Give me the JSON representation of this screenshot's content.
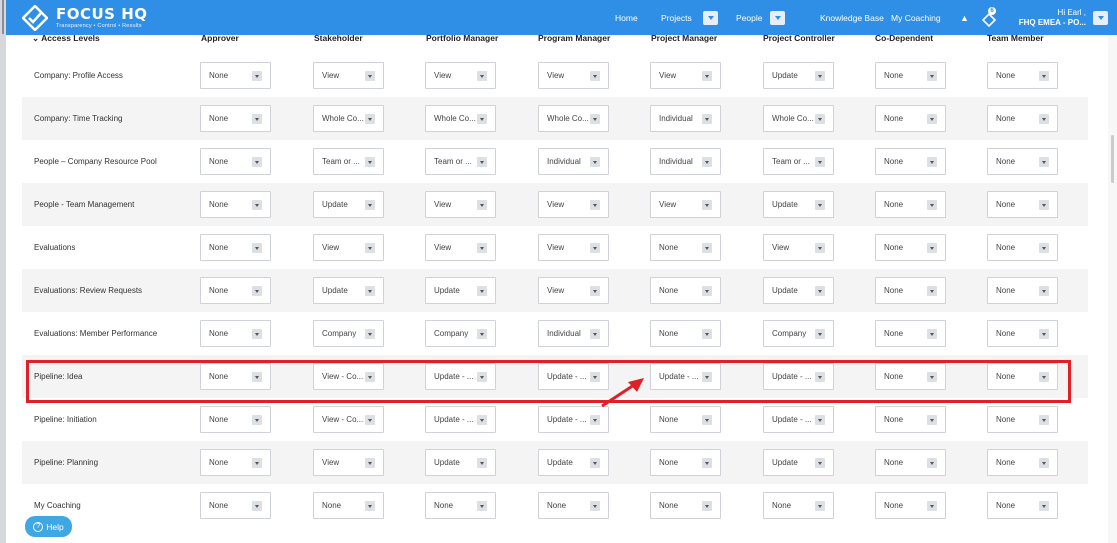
{
  "app": {
    "name": "FOCUS HQ",
    "tagline": "Transparency • Control • Results"
  },
  "nav": {
    "home": "Home",
    "projects": "Projects",
    "people": "People",
    "knowledge_base": "Knowledge Base",
    "my_coaching": "My Coaching",
    "notification_count": "6",
    "greeting": "Hi Earl ,",
    "org": "FHQ EMEA - PO..."
  },
  "table": {
    "first_header": "Access Levels",
    "columns": [
      "Approver",
      "Stakeholder",
      "Portfolio Manager",
      "Program Manager",
      "Project Manager",
      "Project Controller",
      "Co-Dependent",
      "Team Member"
    ],
    "rows": [
      {
        "label": "Company: Profile Access",
        "values": [
          "None",
          "View",
          "View",
          "View",
          "View",
          "Update",
          "None",
          "None"
        ]
      },
      {
        "label": "Company: Time Tracking",
        "values": [
          "None",
          "Whole Co...",
          "Whole Co...",
          "Whole Co...",
          "Individual",
          "Whole Co...",
          "None",
          "None"
        ]
      },
      {
        "label": "People – Company Resource Pool",
        "values": [
          "None",
          "Team or ...",
          "Team or ...",
          "Individual",
          "Individual",
          "Team or ...",
          "None",
          "None"
        ]
      },
      {
        "label": "People - Team Management",
        "values": [
          "None",
          "Update",
          "View",
          "View",
          "View",
          "Update",
          "None",
          "None"
        ]
      },
      {
        "label": "Evaluations",
        "values": [
          "None",
          "View",
          "View",
          "View",
          "None",
          "View",
          "None",
          "None"
        ]
      },
      {
        "label": "Evaluations: Review Requests",
        "values": [
          "None",
          "Update",
          "Update",
          "View",
          "None",
          "Update",
          "None",
          "None"
        ]
      },
      {
        "label": "Evaluations: Member Performance",
        "values": [
          "None",
          "Company",
          "Company",
          "Individual",
          "None",
          "Company",
          "None",
          "None"
        ]
      },
      {
        "label": "Pipeline: Idea",
        "values": [
          "None",
          "View - Co...",
          "Update - ...",
          "Update - ...",
          "Update - ...",
          "Update - ...",
          "None",
          "None"
        ]
      },
      {
        "label": "Pipeline: Initiation",
        "values": [
          "None",
          "View - Co...",
          "Update - ...",
          "Update - ...",
          "None",
          "Update - ...",
          "None",
          "None"
        ]
      },
      {
        "label": "Pipeline: Planning",
        "values": [
          "None",
          "View",
          "Update",
          "Update",
          "None",
          "Update",
          "None",
          "None"
        ]
      },
      {
        "label": "My Coaching",
        "values": [
          "None",
          "None",
          "None",
          "None",
          "None",
          "None",
          "None",
          "None"
        ]
      }
    ]
  },
  "help": {
    "label": "Help"
  },
  "colors": {
    "brand": "#2f8ee6",
    "highlight": "#e01f26",
    "help": "#3ea7e4"
  }
}
